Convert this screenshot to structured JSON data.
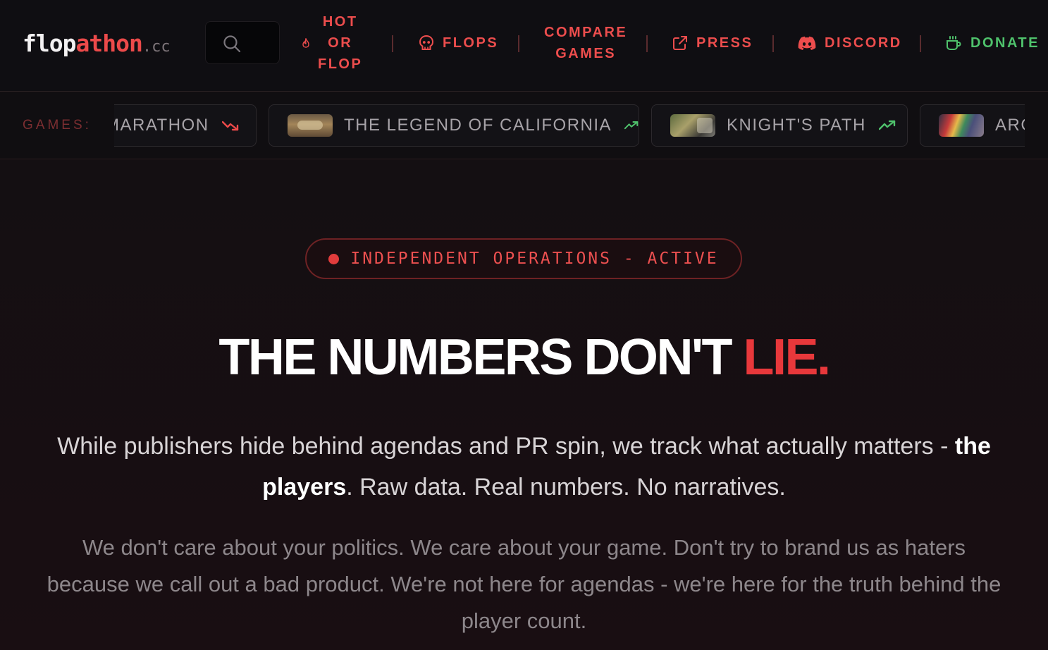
{
  "header": {
    "logo": {
      "part1": "flop",
      "part2": "athon",
      "part3": ".cc"
    },
    "search": {
      "icon": "search-icon"
    },
    "nav": [
      {
        "id": "hot-or-flop",
        "lines": [
          "HOT",
          "OR",
          "FLOP"
        ],
        "icon": "flame-icon"
      },
      {
        "id": "flops",
        "label": "FLOPS",
        "icon": "skull-icon"
      },
      {
        "id": "compare-games",
        "lines": [
          "COMPARE",
          "GAMES"
        ]
      },
      {
        "id": "press",
        "label": "PRESS",
        "icon": "external-link-icon"
      },
      {
        "id": "discord",
        "label": "DISCORD",
        "icon": "discord-icon"
      },
      {
        "id": "donate",
        "label": "DONATE",
        "icon": "coffee-icon",
        "color": "#4fc26c"
      }
    ]
  },
  "ticker": {
    "label": "GAMES:",
    "games": [
      {
        "name": "MARATHON",
        "trend": "down",
        "trend_icon": "trending-down-icon"
      },
      {
        "name": "THE LEGEND OF CALIFORNIA",
        "trend": "up",
        "trend_icon": "trending-up-icon"
      },
      {
        "name": "KNIGHT'S PATH",
        "trend": "up",
        "trend_icon": "trending-up-icon"
      },
      {
        "name": "ARC",
        "trend": "up",
        "trend_icon": "trending-up-icon"
      }
    ]
  },
  "hero": {
    "status": "INDEPENDENT OPERATIONS - ACTIVE",
    "headline": {
      "main": "THE NUMBERS DON'T ",
      "accent": "LIE."
    },
    "lead": {
      "before": "While publishers hide behind agendas and PR spin, we track what actually matters - ",
      "bold": "the players",
      "after": ". Raw data. Real numbers. No narratives."
    },
    "sub": "We don't care about your politics. We care about your game. Don't try to brand us as haters because we call out a bad product. We're not here for agendas - we're here for the truth behind the player count."
  },
  "colors": {
    "accent": "#ec4a4a",
    "donate": "#4fc26c",
    "trend_up": "#4fc26c",
    "trend_down": "#ec4a4a"
  }
}
